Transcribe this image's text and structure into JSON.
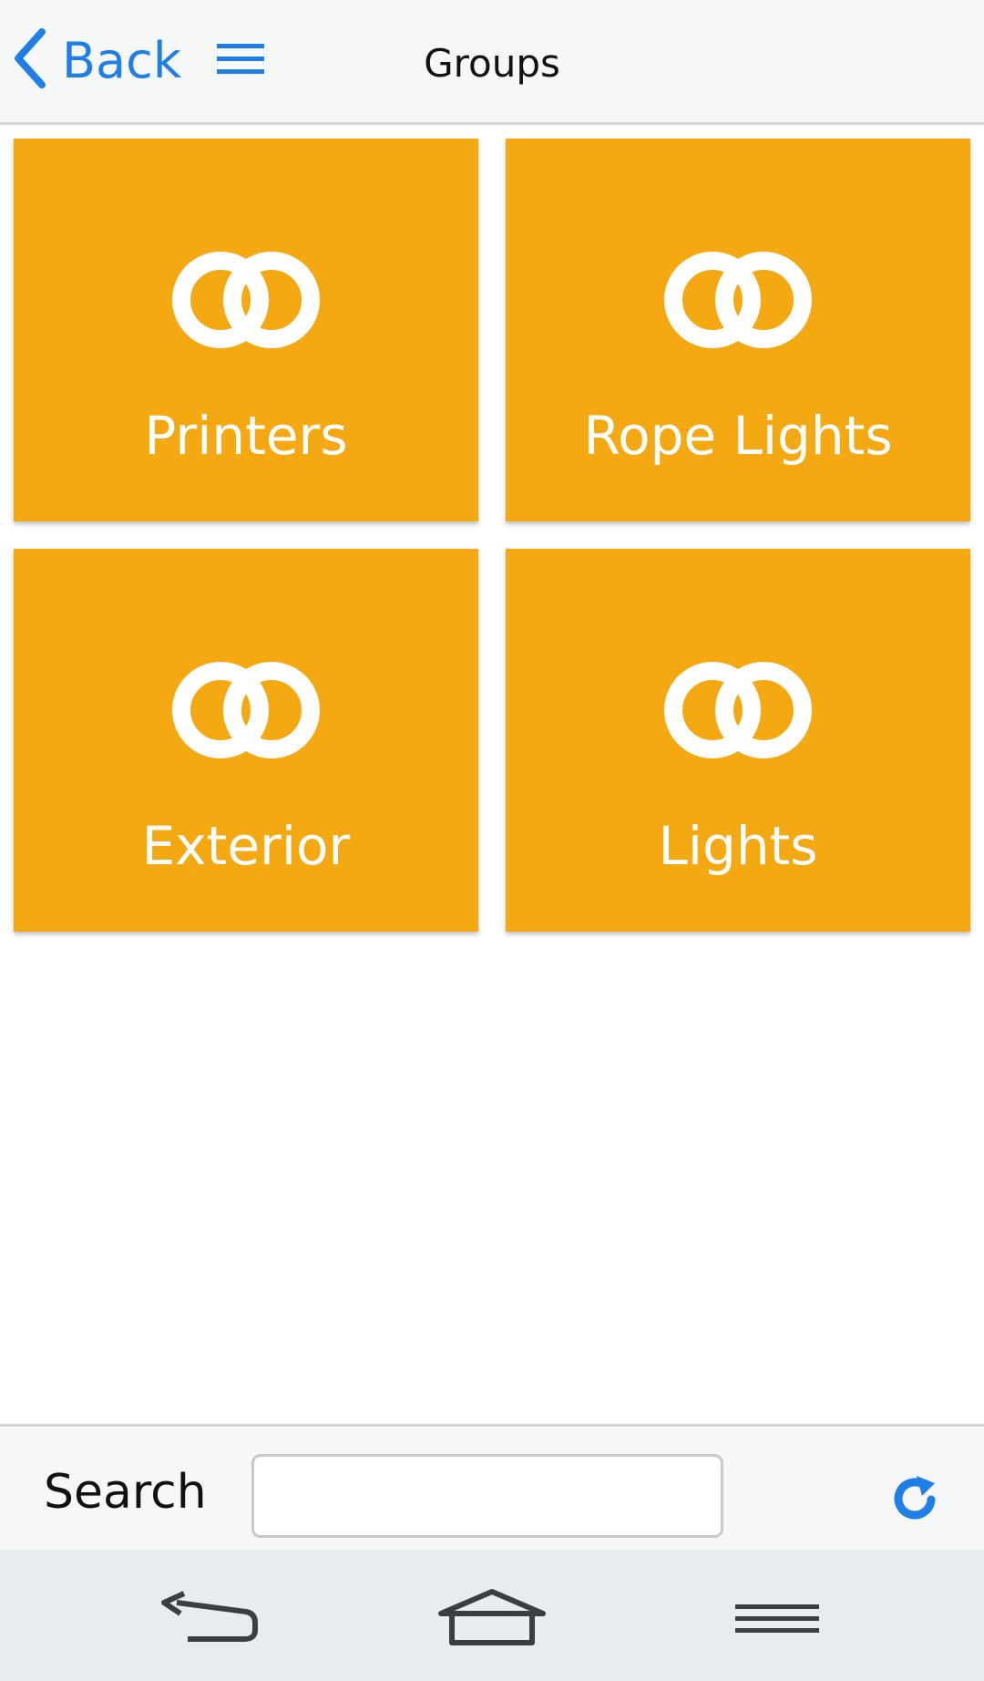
{
  "header": {
    "back_label": "Back",
    "title": "Groups",
    "icons": {
      "back": "chevron-left-icon",
      "menu": "hamburger-menu-icon"
    }
  },
  "tiles": [
    {
      "label": "Printers",
      "icon": "linked-rings-icon"
    },
    {
      "label": "Rope Lights",
      "icon": "linked-rings-icon"
    },
    {
      "label": "Exterior",
      "icon": "linked-rings-icon"
    },
    {
      "label": "Lights",
      "icon": "linked-rings-icon"
    }
  ],
  "search": {
    "label": "Search",
    "value": "",
    "placeholder": "",
    "refresh_icon": "refresh-icon"
  },
  "nav": {
    "icons": [
      "back-arrow-icon",
      "home-icon",
      "menu-lines-icon"
    ]
  },
  "colors": {
    "accent": "#1f7fe6",
    "tile": "#f4a811",
    "header_bg": "#f6f7f7",
    "nav_bg": "#e9ecee"
  }
}
